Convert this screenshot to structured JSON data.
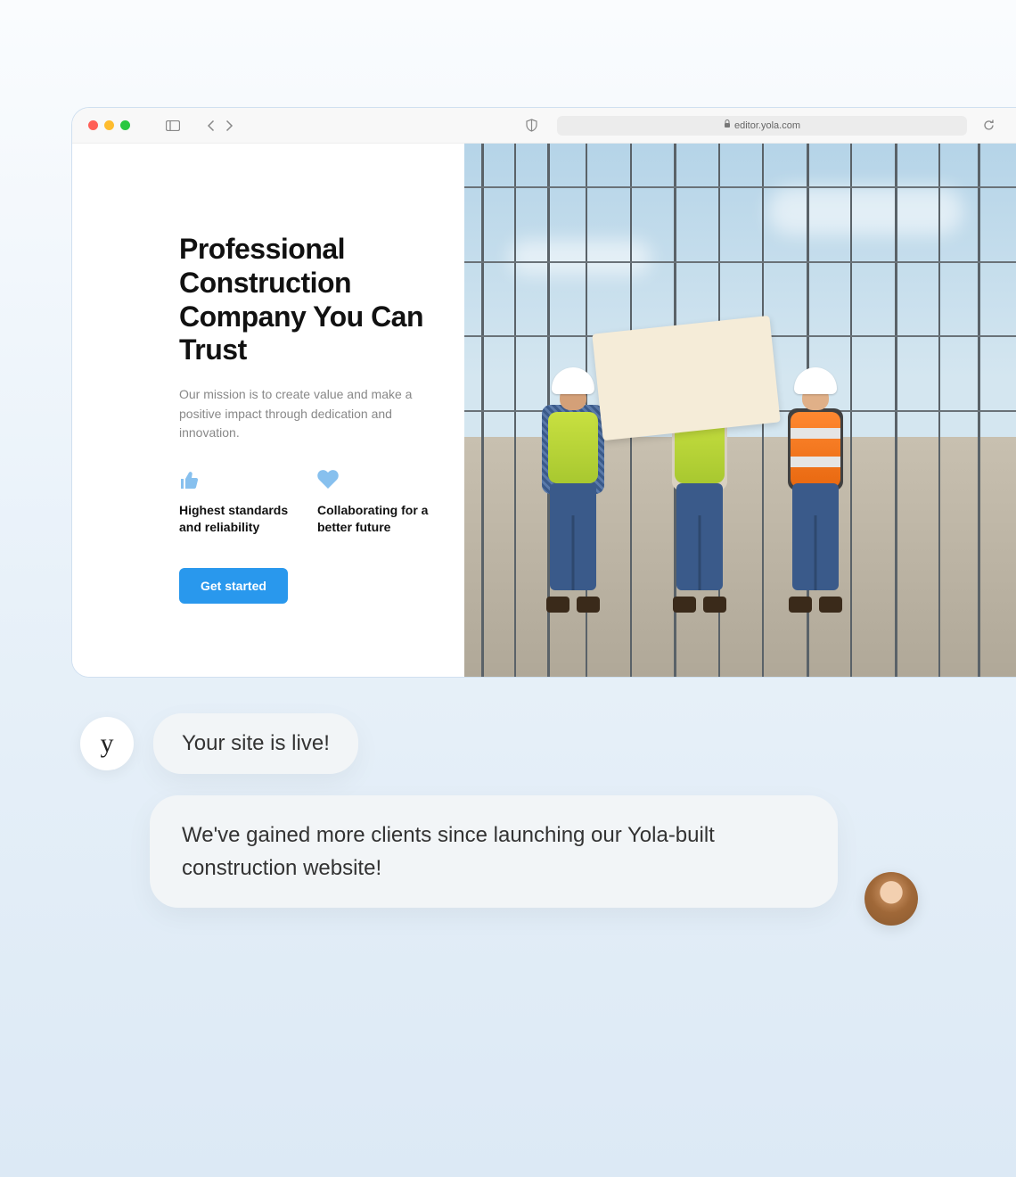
{
  "browser": {
    "url": "editor.yola.com",
    "lock_icon": "lock-icon"
  },
  "hero": {
    "title": "Professional Construction Company You Can Trust",
    "subtitle": "Our mission is to create value and make a positive impact through dedication and innovation.",
    "features": [
      {
        "icon": "thumbs-up-icon",
        "text": "Highest standards and reliability"
      },
      {
        "icon": "heart-icon",
        "text": "Collaborating for a better future"
      }
    ],
    "cta_label": "Get started"
  },
  "chat": {
    "avatar_letter": "y",
    "bubble1": "Your site is live!",
    "bubble2": "We've gained more clients since launching our Yola-built construction website!"
  },
  "colors": {
    "accent": "#2998ed",
    "icon_blue": "#87c0ee"
  }
}
